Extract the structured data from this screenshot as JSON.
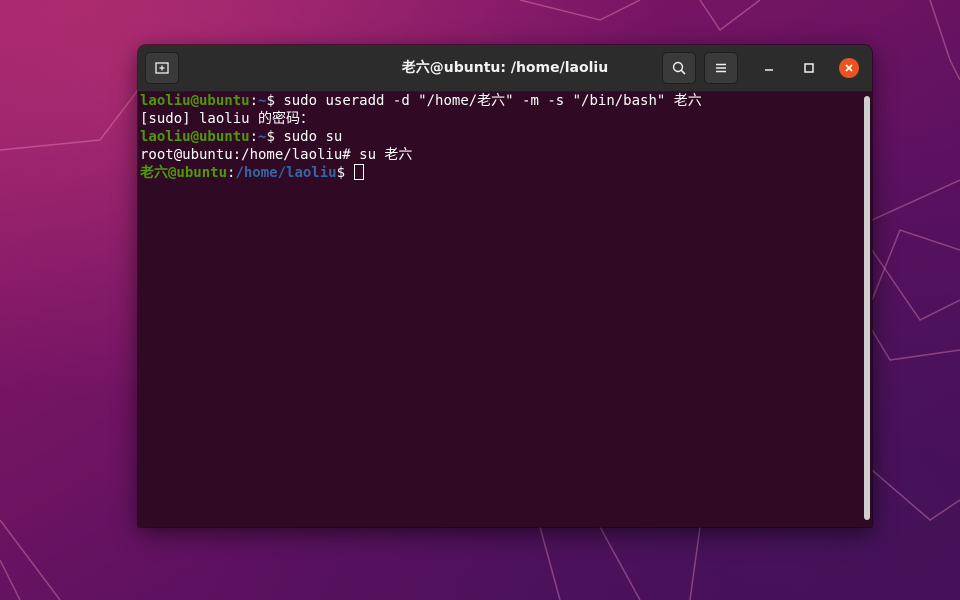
{
  "window": {
    "title": "老六@ubuntu: /home/laoliu"
  },
  "toolbar": {
    "new_tab_icon": "new-tab-icon",
    "search_icon": "search-icon",
    "menu_icon": "hamburger-menu-icon",
    "minimize_icon": "minimize-icon",
    "maximize_icon": "maximize-icon",
    "close_icon": "close-icon"
  },
  "colors": {
    "user_prompt": "#4e9a06",
    "path_prompt": "#3465a4",
    "terminal_bg": "#300a24",
    "close_button": "#e95420"
  },
  "terminal": {
    "lines": [
      {
        "user": "laoliu@ubuntu",
        "sep": ":",
        "path": "~",
        "sigil": "$ ",
        "cmd": "sudo useradd -d \"/home/老六\" -m -s \"/bin/bash\" 老六"
      },
      {
        "text": "[sudo] laoliu 的密码："
      },
      {
        "user": "laoliu@ubuntu",
        "sep": ":",
        "path": "~",
        "sigil": "$ ",
        "cmd": "sudo su"
      },
      {
        "text": "root@ubuntu:/home/laoliu# su 老六"
      },
      {
        "user": "老六@ubuntu",
        "sep": ":",
        "path": "/home/laoliu",
        "sigil": "$ ",
        "cmd": ""
      }
    ]
  }
}
